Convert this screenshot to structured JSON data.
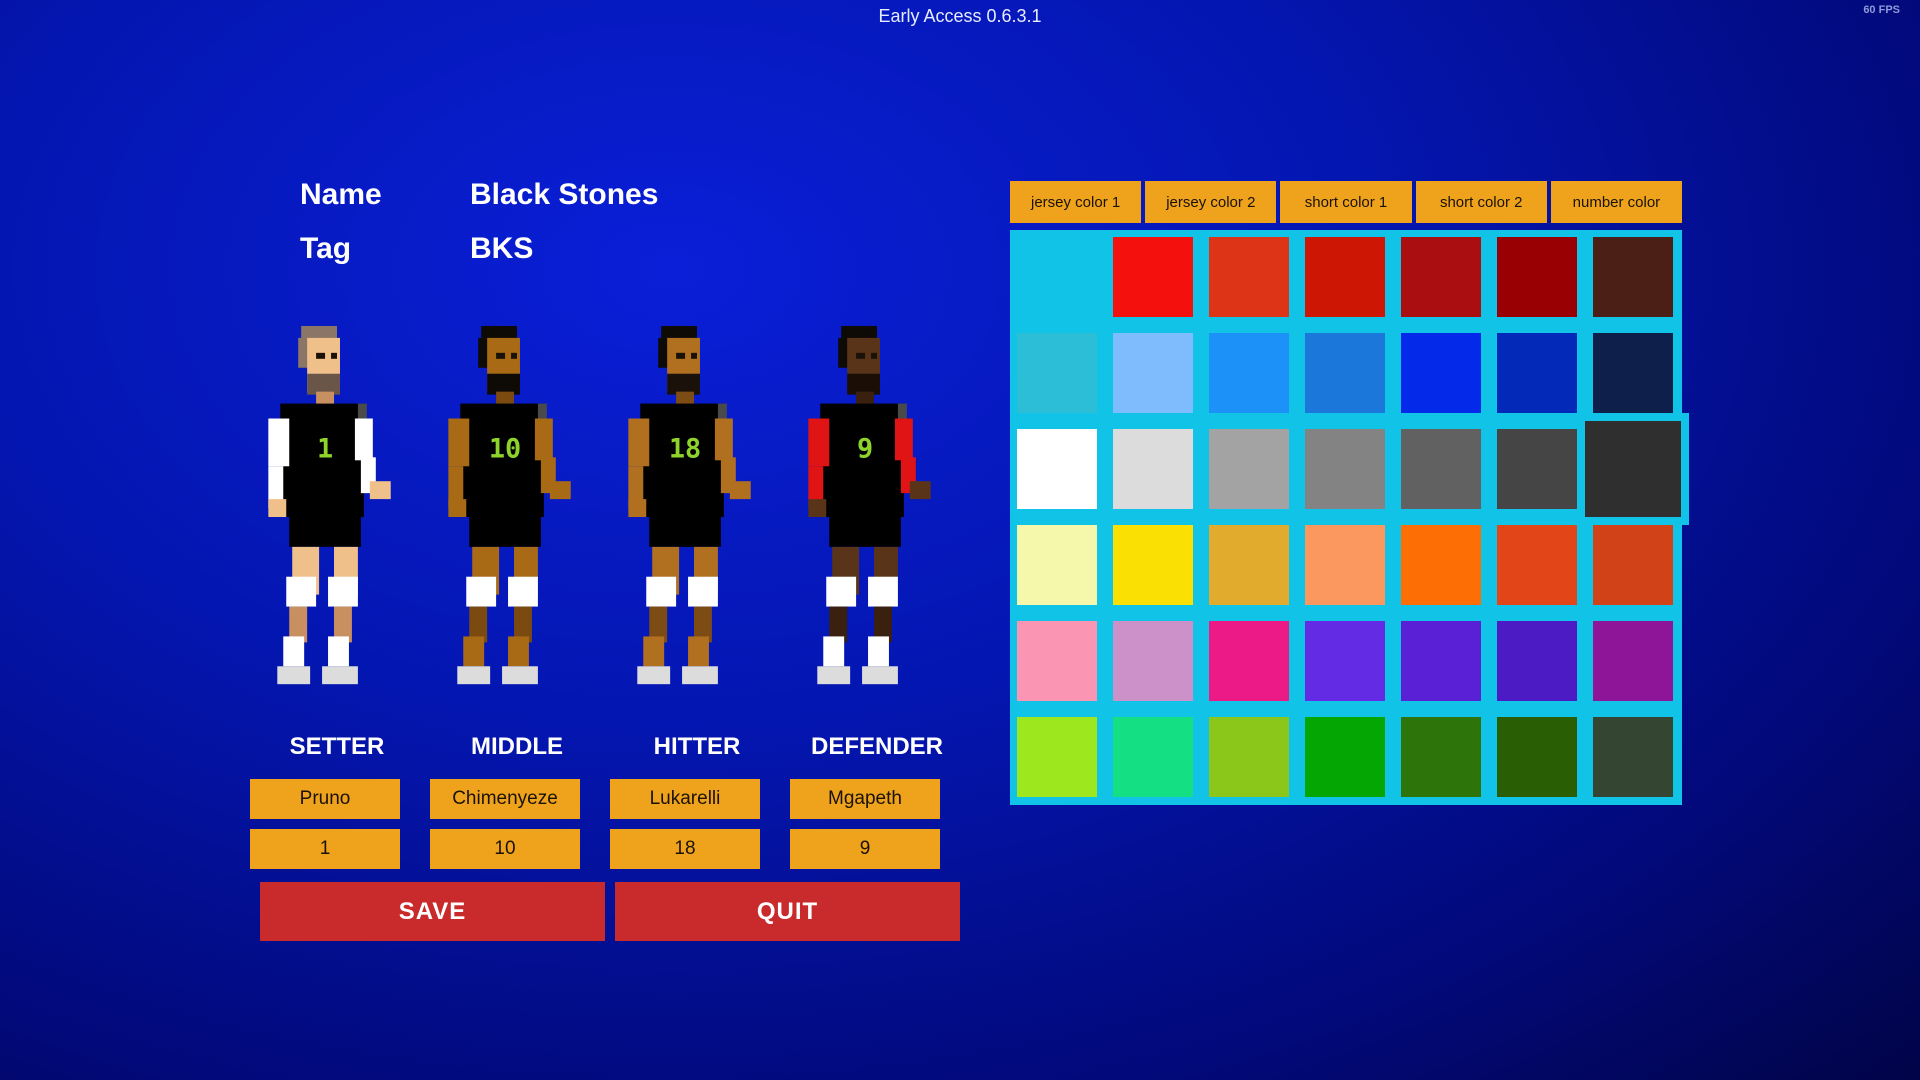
{
  "version": "Early Access 0.6.3.1",
  "fps": "60 FPS",
  "team": {
    "name_label": "Name",
    "name_value": "Black Stones",
    "tag_label": "Tag",
    "tag_value": "BKS"
  },
  "players": [
    {
      "role": "SETTER",
      "name": "Pruno",
      "number": "1",
      "skin": "#f0c08a",
      "skin_dark": "#c89060",
      "hair": "#8a7566",
      "beard": "#6a5648",
      "sleeve": "#ffffff",
      "shin": "#ffffff"
    },
    {
      "role": "MIDDLE",
      "name": "Chimenyeze",
      "number": "10",
      "skin": "#a86a14",
      "skin_dark": "#7a4a10",
      "hair": "#0e0a06",
      "beard": "#0e0a06",
      "sleeve": "#a86a14",
      "shin": "#a86a14"
    },
    {
      "role": "HITTER",
      "name": "Lukarelli",
      "number": "18",
      "skin": "#b07020",
      "skin_dark": "#7c4c14",
      "hair": "#0e0a06",
      "beard": "#1a120a",
      "sleeve": "#b07020",
      "shin": "#b07020"
    },
    {
      "role": "DEFENDER",
      "name": "Mgapeth",
      "number": "9",
      "skin": "#5a3418",
      "skin_dark": "#3a200e",
      "hair": "#0e0a06",
      "beard": "#1a0e06",
      "sleeve": "#e01414",
      "shin": "#ffffff"
    }
  ],
  "buttons": {
    "save": "SAVE",
    "quit": "QUIT"
  },
  "tabs": [
    "jersey color 1",
    "jersey color 2",
    "short color 1",
    "short color 2",
    "number color"
  ],
  "palette": [
    [
      "#11c3e6",
      "#f4100c",
      "#dd3317",
      "#ce1604",
      "#ab0e10",
      "#980003",
      "#4b1f16"
    ],
    [
      "#2bbed6",
      "#7fbcfd",
      "#1c92f9",
      "#1b77d9",
      "#0429e8",
      "#0329b9",
      "#0e1f4c"
    ],
    [
      "#ffffff",
      "#dcdcdc",
      "#a3a3a3",
      "#838383",
      "#616161",
      "#454545",
      "#2f2f2f"
    ],
    [
      "#f5f7ab",
      "#fbe003",
      "#e1ac2d",
      "#fa9860",
      "#fd6f05",
      "#e14518",
      "#d24219"
    ],
    [
      "#fa96b4",
      "#cc91c8",
      "#eb1a86",
      "#642be5",
      "#5a20d6",
      "#4c1bc3",
      "#8f1598"
    ],
    [
      "#9ce71e",
      "#14df82",
      "#8bc61b",
      "#03a603",
      "#2d740a",
      "#2a5e05",
      "#344631"
    ]
  ],
  "selected_swatch": "#2f2f2f",
  "colors": {
    "jersey": "#000000",
    "shorts": "#000000",
    "number_color": "#8fd42a",
    "button_red": "#c92a2c",
    "field_orange": "#efa31c",
    "palette_bg": "#11c3e6"
  }
}
